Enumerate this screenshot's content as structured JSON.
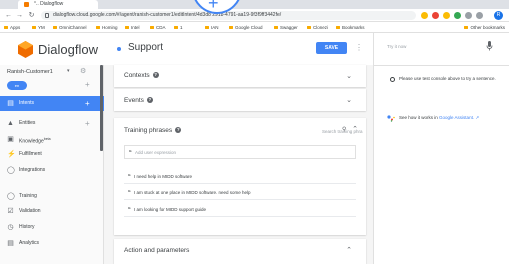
{
  "browser": {
    "tab_title": "°.. Dialogflow",
    "url": "dialogflow.cloud.google.com/#/agent/ranish-customer1/editIntent/4d3d8 291b-4791-aa19-9f3f9ff3442fe/",
    "bookmarks": [
      "Apps",
      "YM",
      "OmniChannel",
      "Homing",
      "Intel",
      "CDA",
      "1",
      "IAN",
      "Google Cloud",
      "Swagger",
      "Clonezi",
      "Bookmarks"
    ],
    "other_bookmarks": "Other bookmarks",
    "profile_initial": "R"
  },
  "app": {
    "logo_text": "Dialogflow",
    "page_title": "Support",
    "save_label": "SAVE"
  },
  "sidebar": {
    "agent_name": "Ranish-Customer1",
    "language_chip": "en",
    "items": [
      {
        "label": "Intents",
        "icon": "chat-bubble-icon",
        "active": true,
        "plus": true
      },
      {
        "label": "Entities",
        "icon": "entities-icon",
        "active": false,
        "plus": true
      },
      {
        "label": "Knowledge",
        "sup": "beta",
        "icon": "knowledge-icon",
        "active": false,
        "plus": false
      },
      {
        "label": "Fulfillment",
        "icon": "lightning-icon",
        "active": false,
        "plus": false
      },
      {
        "label": "Integrations",
        "icon": "integrations-icon",
        "active": false,
        "plus": false
      },
      {
        "label": "Training",
        "icon": "training-icon",
        "active": false,
        "plus": false
      },
      {
        "label": "Validation",
        "icon": "validation-icon",
        "active": false,
        "plus": false
      },
      {
        "label": "History",
        "icon": "history-icon",
        "active": false,
        "plus": false
      },
      {
        "label": "Analytics",
        "icon": "analytics-icon",
        "active": false,
        "plus": false
      }
    ]
  },
  "main": {
    "sections": {
      "contexts": "Contexts",
      "events": "Events",
      "training_phrases": "Training phrases",
      "action_parameters": "Action and parameters"
    },
    "search_placeholder": "Search training phra",
    "add_expression_placeholder": "Add user expression",
    "phrases": [
      "I need help in MIDD software",
      "I am stuck at one place in MIDD software. need some help",
      "I am looking for MIDD support guide"
    ]
  },
  "tryit": {
    "placeholder": "Try it now",
    "info": "Please use test console above to try a sentence.",
    "ga_prefix": "See how it works in",
    "ga_link": "Google Assistant."
  },
  "colors": {
    "accent": "#4285f4",
    "logo_orange": "#ef6c00"
  }
}
